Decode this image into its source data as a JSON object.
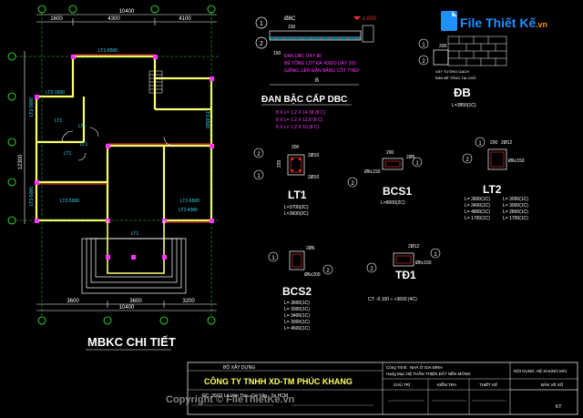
{
  "colors": {
    "background": "#000000",
    "wall": "#ffff66",
    "dim": "#ffffff",
    "red": "#ff3030",
    "magenta": "#ff33ff",
    "cyan": "#33ddff",
    "green": "#33ff33",
    "grid_bubble": "#33ff33",
    "logo_blue": "#1e90ff",
    "logo_orange": "#ff8c00"
  },
  "plan": {
    "title": "MBKC CHI TIẾT",
    "top_dims": [
      "1600",
      "4300",
      "4100"
    ],
    "top_total": "10400",
    "bottom_dims": [
      "3600",
      "3600",
      "3200"
    ],
    "bottom_total": "10400",
    "left_dims": [
      "12300"
    ],
    "beams": {
      "top": "LT1-6500",
      "top_left": "LT2-1600",
      "right_upper": "LT1-6500",
      "right_lower": "LT1-6500",
      "left_upper": "LT2-5000",
      "left_lower": "LT2-5000",
      "bottom_left": "LT2-5000",
      "bottom_right": "LT2-4000",
      "middle": "LT1",
      "lintel_a": "LT1",
      "lintel_b": "LT1",
      "lintel_c": "LT1",
      "entrance": "LT1"
    }
  },
  "slab": {
    "title": "ĐAN BẬC CẤP DBC",
    "level": "-1.000",
    "dim_top": "150",
    "dim_left": "150",
    "bar_text": "Ø8C",
    "notes": [
      "ĐAN DBC DÀY 80",
      "BÊ TÔNG LÓT ĐÁ 40X60 DÀY 100",
      "GIẰNG LIÊN ĐÂN BẰNG CỐT THÉP"
    ],
    "dim_bottom": "B",
    "lengths": [
      "8 X L= 1.2 X 14.38 (8 C)",
      "8 X L= 1.2 X 12.8 (8 C)",
      "8 X L= 1.2 X 10 (8 C)"
    ]
  },
  "db": {
    "title": "ĐB",
    "length": "L=3850(1C)",
    "dim": "200",
    "note_a": "XÂY TƯỜNG GẠCH",
    "note_b": "BẢN BÊ TÔNG TẠI CHỖ"
  },
  "lt1": {
    "title": "LT1",
    "dims": [
      "200",
      "220"
    ],
    "bars": [
      "2Ø10",
      "2Ø10"
    ],
    "markers": [
      "1",
      "2"
    ],
    "lengths": [
      "L=3700(2C)",
      "L=3600(2C)"
    ]
  },
  "bcs1": {
    "title": "BCS1",
    "dims": [
      "200"
    ],
    "bars": [
      "2Ø6",
      "Ø6c150"
    ],
    "markers": [
      "1",
      "2"
    ],
    "lengths": [
      "L=8000(2C)"
    ]
  },
  "lt2": {
    "title": "LT2",
    "dims": [
      "200"
    ],
    "bars": [
      "2Ø12",
      "Ø6c150"
    ],
    "markers": [
      "1",
      "2"
    ],
    "lengths_left": [
      "L= 3600(1C)",
      "L= 3400(1C)",
      "L= 4800(1C)",
      "L= 1700(1C)"
    ],
    "lengths_right": [
      "L= 3000(1C)",
      "L= 3000(1C)",
      "L= 2800(1C)",
      "L= 1700(1C)"
    ]
  },
  "bcs2": {
    "title": "BCS2",
    "bars": [
      "2Ø6",
      "Ø6c200"
    ],
    "markers": [
      "1",
      "2"
    ],
    "lengths": [
      "L= 3600(1C)",
      "L= 3000(1C)",
      "L= 3400(1C)",
      "L= 3000(1C)",
      "L= 4600(1C)"
    ]
  },
  "td1": {
    "title": "TĐ1",
    "bars": [
      "2Ø12",
      "Ø6c150"
    ],
    "markers": [
      "1",
      "2"
    ],
    "elevation": "CT: -0.100 ÷ +3600 (4C)"
  },
  "title_block": {
    "header": "BỘ XÂY DỰNG",
    "company": "CÔNG TY TNHH XD-TM PHÚC KHANG",
    "address": "ĐC: 30/12 Lê Văn Thọ - Gò Vấp - Tp.HCM",
    "project_label": "Công Trình:",
    "project": "NHÀ Ở GIA ĐÌNH",
    "item_label": "Hạng Mục:",
    "item": "HỆ THẦN THIỆN ĐẤT NỀN MÓNG",
    "content": "NỘI DUNG: HỆ KHUNG MÁI",
    "col_a": "CHỦ TRÌ",
    "col_b": "KIỂM TRA",
    "col_c": "THIẾT KẾ",
    "sheet_label": "BẢN VẼ SỐ",
    "scale": "KT"
  },
  "watermark": {
    "logo_text": "File Thiết Kế",
    "logo_domain": ".vn",
    "copyright": "Copyright © FileThietKe.vn"
  }
}
